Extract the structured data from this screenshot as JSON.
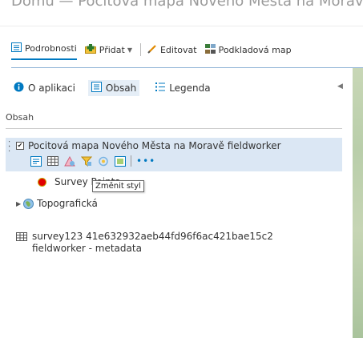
{
  "app": {
    "title": "Pocitová mapa Nového Města na Moravě",
    "title_prefix": "Domů"
  },
  "toolbar": {
    "details_label": "Podrobnosti",
    "add_label": "Přidat",
    "edit_label": "Editovat",
    "basemap_label": "Podkladová map"
  },
  "panel": {
    "tabs": [
      {
        "label": "O aplikaci",
        "icon": "info-icon"
      },
      {
        "label": "Obsah",
        "icon": "content-icon"
      },
      {
        "label": "Legenda",
        "icon": "legend-icon"
      }
    ],
    "section_title": "Obsah",
    "layers": {
      "main_title": "Pocitová mapa Nového Města na Moravě fieldworker",
      "main_checked": true,
      "legend_label": "Survey Points",
      "tooltip": "Změnit styl",
      "basemap_group": "Topografická",
      "table_title": "survey123 41e632932aeb44fd96f6ac421bae15c2 fieldworker - metadata"
    }
  },
  "colors": {
    "accent": "#0079c1",
    "selected_row": "#dbe7f4",
    "point_symbol": "#e00000"
  }
}
